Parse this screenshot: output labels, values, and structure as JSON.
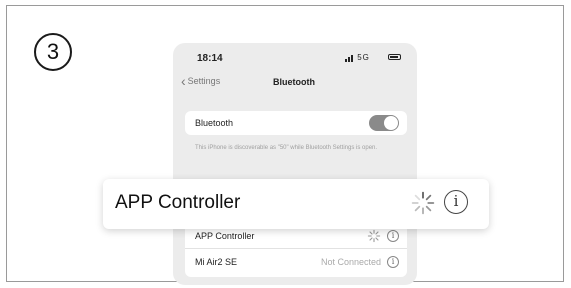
{
  "step": {
    "number": "3"
  },
  "phone": {
    "status_bar": {
      "time": "18:14",
      "network": "5G"
    },
    "nav": {
      "back_label": "Settings",
      "title": "Bluetooth"
    },
    "bluetooth_row": {
      "label": "Bluetooth",
      "enabled": true
    },
    "discoverable_text": "This iPhone is discoverable as \"50\" while Bluetooth Settings is open.",
    "devices": [
      {
        "name": "APP Controller",
        "status": "",
        "connecting": true
      },
      {
        "name": "Mi Air2 SE",
        "status": "Not Connected",
        "connecting": false
      }
    ]
  },
  "callout": {
    "name": "APP Controller"
  },
  "icons": {
    "info": "info-icon",
    "spinner": "loading-spinner-icon",
    "back": "chevron-left-icon"
  },
  "colors": {
    "toggle_on": "#8a8a8a",
    "background": "#ececec"
  }
}
